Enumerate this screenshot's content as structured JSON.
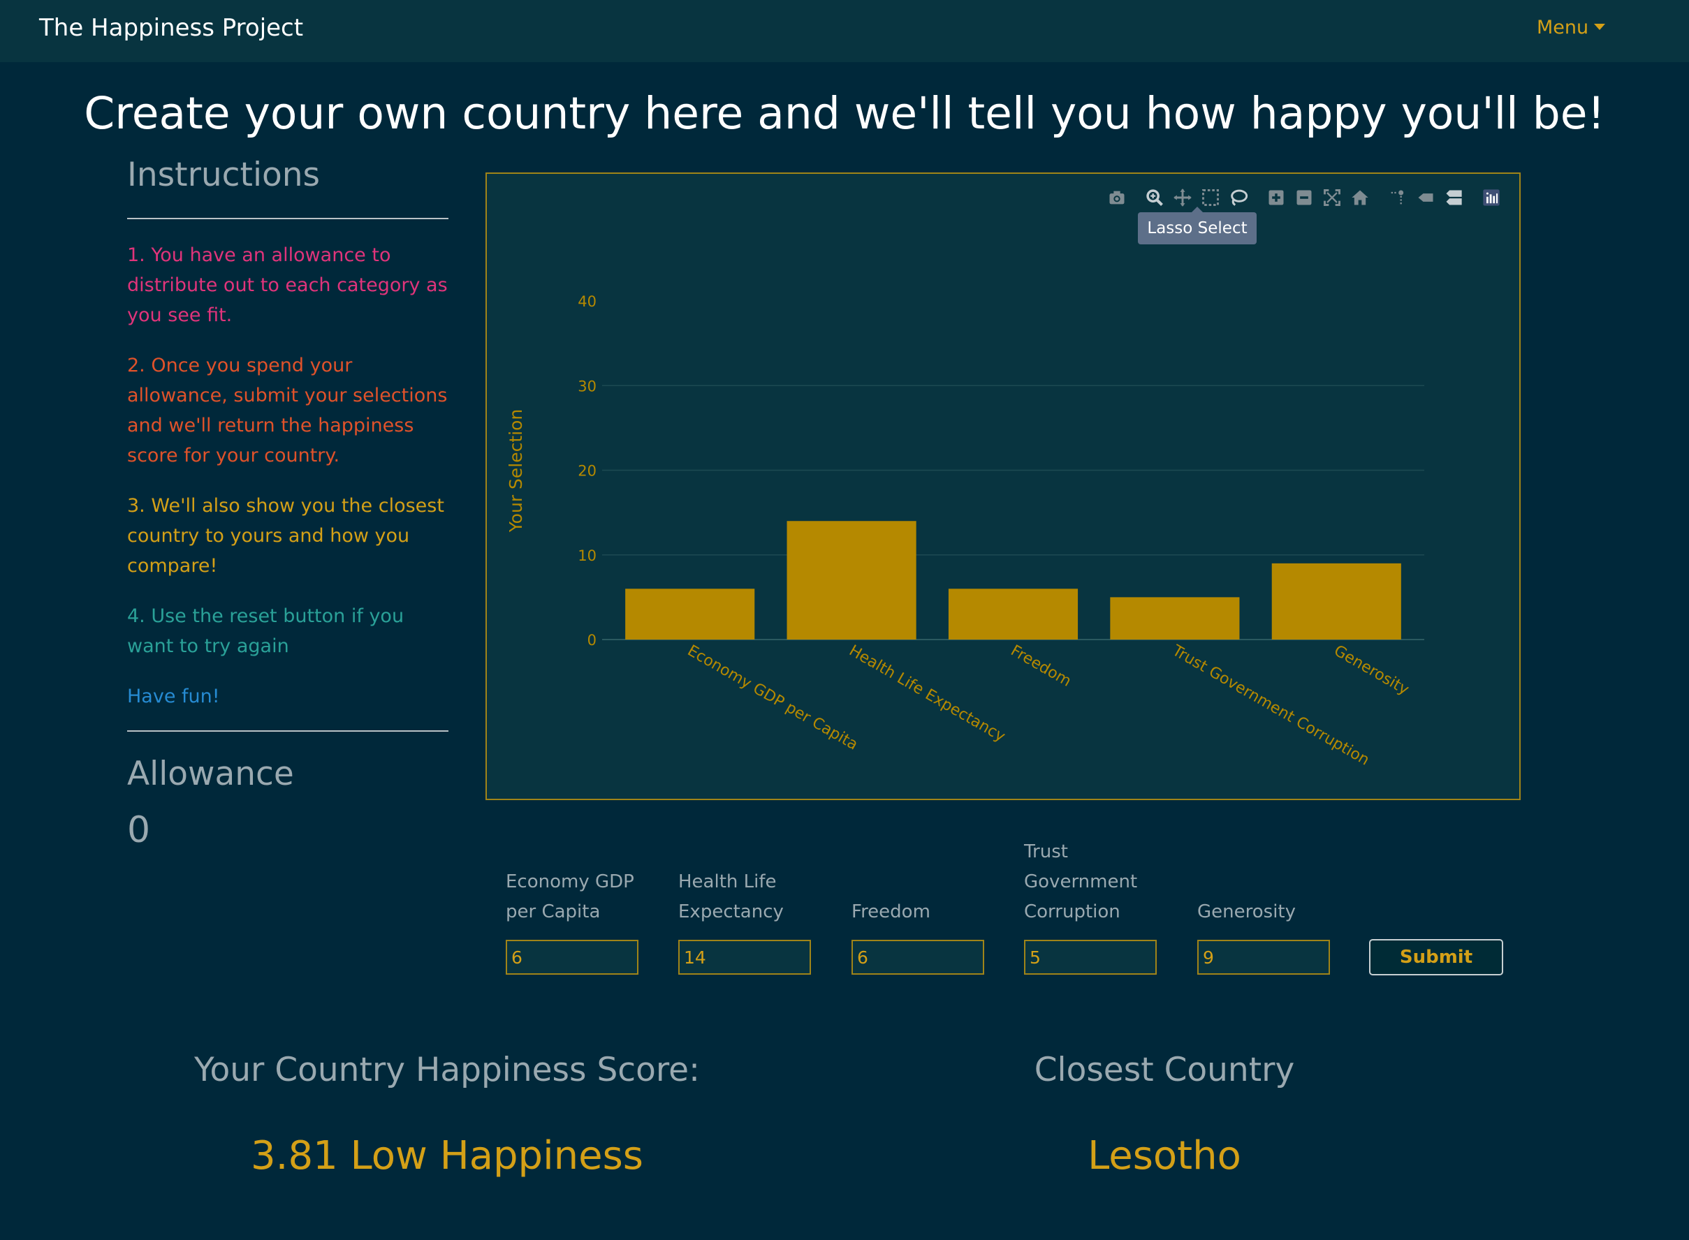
{
  "navbar": {
    "brand": "The Happiness Project",
    "menu_label": "Menu"
  },
  "headline": "Create your own country here and we'll tell you how happy you'll be!",
  "sidebar": {
    "instructions_heading": "Instructions",
    "instructions": [
      "1. You have an allowance to distribute out to each category as you see fit.",
      "2. Once you spend your allowance, submit your selections and we'll return the happiness score for your country.",
      "3. We'll also show you the closest country to yours and how you compare!",
      "4. Use the reset button if you want to try again",
      "Have fun!"
    ],
    "allowance_heading": "Allowance",
    "allowance_value": "0"
  },
  "modebar": {
    "icons": [
      "camera-icon",
      "zoom-icon",
      "pan-icon",
      "box-select-icon",
      "lasso-select-icon",
      "zoom-in-icon",
      "zoom-out-icon",
      "autoscale-icon",
      "reset-axes-icon",
      "spike-lines-icon",
      "hover-closest-icon",
      "hover-compare-icon",
      "plotly-logo-icon"
    ],
    "tooltip": "Lasso Select"
  },
  "chart_data": {
    "type": "bar",
    "categories": [
      "Economy GDP per Capita",
      "Health Life Expectancy",
      "Freedom",
      "Trust Government Corruption",
      "Generosity"
    ],
    "values": [
      6,
      14,
      6,
      5,
      9
    ],
    "title": "",
    "xlabel": "",
    "ylabel": "Your Selection",
    "ylim": [
      0,
      40
    ],
    "yticks": [
      0,
      10,
      20,
      30,
      40
    ],
    "grid": true,
    "bar_color": "#b58900"
  },
  "form": {
    "fields": [
      {
        "label": "Economy GDP per Capita",
        "value": "6"
      },
      {
        "label": "Health Life Expectancy",
        "value": "14"
      },
      {
        "label": "Freedom",
        "value": "6"
      },
      {
        "label": "Trust Government Corruption",
        "value": "5"
      },
      {
        "label": "Generosity",
        "value": "9"
      }
    ],
    "submit_label": "Submit"
  },
  "results": {
    "score_title": "Your Country Happiness Score:",
    "score_value": "3.81 Low Happiness",
    "closest_title": "Closest Country",
    "closest_value": "Lesotho"
  },
  "colors": {
    "background": "#00283a",
    "navbar": "#083440",
    "accent": "#d4a017",
    "muted_text": "#9aa9b0"
  }
}
